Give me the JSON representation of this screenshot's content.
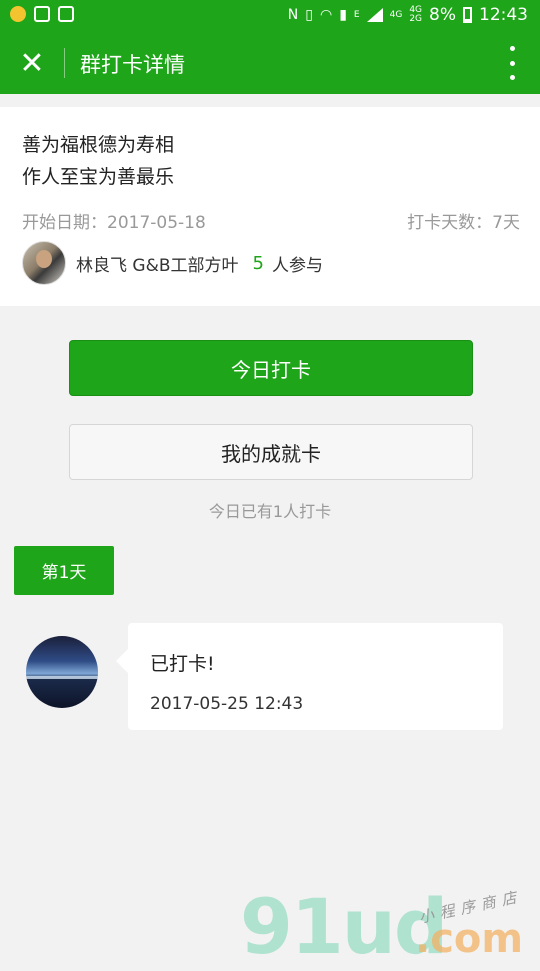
{
  "status_bar": {
    "wifi_4g_a": "4G",
    "wifi_4g_b": "4G",
    "wifi_2g": "2G",
    "battery": "8%",
    "time": "12:43",
    "network_e": "E"
  },
  "app_bar": {
    "title": "群打卡详情",
    "close_glyph": "✕"
  },
  "info": {
    "motto_line1": "善为福根德为寿相",
    "motto_line2": "作人至宝为善最乐",
    "start_date": "开始日期：2017-05-18",
    "days": "打卡天数：7天",
    "owner_name": "林良飞 G&B工部方叶",
    "participants_count": "5",
    "participants_label": "人参与"
  },
  "actions": {
    "checkin_label": "今日打卡",
    "achievement_label": "我的成就卡",
    "today_summary": "今日已有1人打卡"
  },
  "feed": {
    "day_label": "第1天",
    "posts": [
      {
        "text": "已打卡!",
        "time": "2017-05-25 12:43"
      }
    ]
  },
  "watermark": {
    "brand": "91ud",
    "suffix": ".com",
    "tagline": "小程序商店"
  },
  "colors": {
    "accent": "#1fa51a",
    "background": "#f2f2f2"
  }
}
